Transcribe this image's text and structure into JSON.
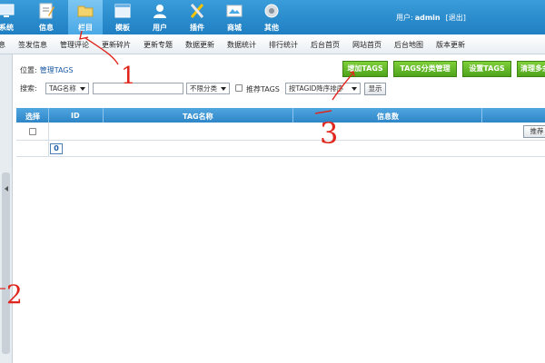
{
  "header": {
    "nav": [
      {
        "label": "系统",
        "icon": "computer-icon"
      },
      {
        "label": "信息",
        "icon": "pencil-icon"
      },
      {
        "label": "栏目",
        "icon": "folder-icon",
        "active": true
      },
      {
        "label": "模板",
        "icon": "window-icon"
      },
      {
        "label": "用户",
        "icon": "user-icon"
      },
      {
        "label": "插件",
        "icon": "tools-icon"
      },
      {
        "label": "商城",
        "icon": "shop-icon"
      },
      {
        "label": "其他",
        "icon": "gear-icon"
      }
    ],
    "user_prefix": "用户:",
    "username": "admin",
    "logout": "[退出]"
  },
  "subnav": [
    "息",
    "签发信息",
    "管理评论",
    "更新碎片",
    "更新专题",
    "数据更新",
    "数据统计",
    "排行统计",
    "后台首页",
    "网站首页",
    "后台地图",
    "版本更新"
  ],
  "location": {
    "label": "位置:",
    "link": "管理TAGS"
  },
  "actions": [
    "增加TAGS",
    "TAGS分类管理",
    "设置TAGS",
    "清理多余"
  ],
  "search": {
    "label": "搜索:",
    "field_select": "TAG名称",
    "keyword": "",
    "class_select": "不限分类",
    "recommend_label": "推荐TAGS",
    "order_select": "按TAGID降序排序",
    "button": "显示"
  },
  "table": {
    "headers": [
      "选择",
      "ID",
      "TAG名称",
      "信息数"
    ],
    "recommend_button": "推荐",
    "page_number": "0"
  },
  "annotations": [
    "1",
    "2",
    "3"
  ],
  "colors": {
    "header": "#2a8fd0",
    "accent_green": "#5cb52a",
    "annotation_red": "#e0261c"
  }
}
